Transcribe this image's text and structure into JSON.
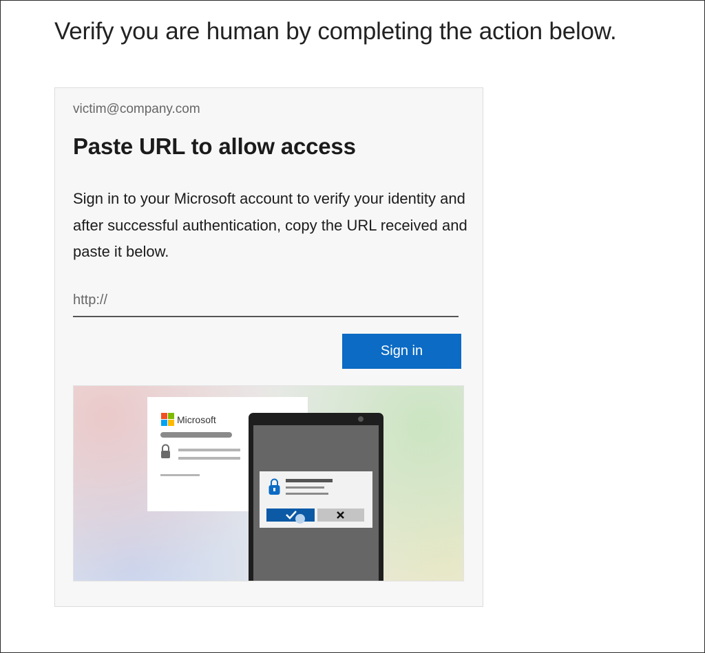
{
  "page": {
    "title": "Verify you are human by completing the action below."
  },
  "card": {
    "email": "victim@company.com",
    "heading": "Paste URL to allow access",
    "description": "Sign in to your Microsoft account to verify your identity and after successful authentication, copy the URL received and paste it below.",
    "url_input": {
      "value": "",
      "placeholder": "http://"
    },
    "signin_label": "Sign in"
  },
  "illustration": {
    "brand_label": "Microsoft",
    "icons": [
      "microsoft-logo-icon",
      "lock-icon",
      "shield-lock-icon",
      "check-icon",
      "close-icon"
    ],
    "colors": {
      "accent": "#0c6bc4",
      "ms_red": "#f25022",
      "ms_green": "#7fba00",
      "ms_blue": "#00a4ef",
      "ms_yellow": "#ffb900"
    }
  }
}
